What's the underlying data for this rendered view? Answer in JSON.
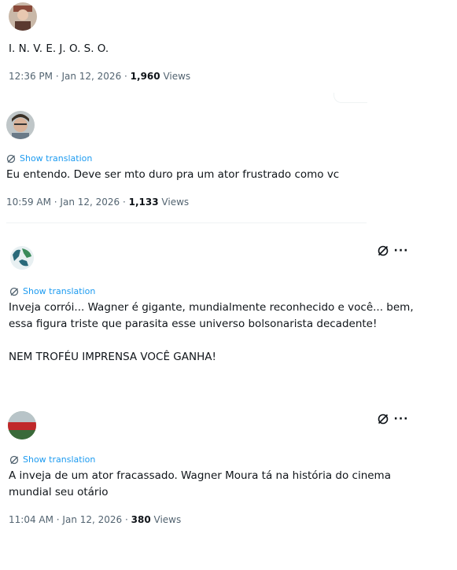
{
  "tweets": [
    {
      "text": "I. N. V. E. J. O. S. O.",
      "time": "12:36 PM",
      "date": "Jan 12, 2026",
      "views_count": "1,960",
      "views_label": "Views"
    },
    {
      "translation_label": "Show translation",
      "text": "Eu entendo. Deve ser mto duro pra um ator frustrado como vc",
      "time": "10:59 AM",
      "date": "Jan 12, 2026",
      "views_count": "1,133",
      "views_label": "Views"
    },
    {
      "translation_label": "Show translation",
      "text": "Inveja corrói... Wagner é gigante, mundialmente reconhecido e você... bem,\nessa figura triste que parasita esse universo bolsonarista decadente!\n\nNEM TROFÉU IMPRENSA VOCÊ GANHA!"
    },
    {
      "translation_label": "Show translation",
      "text": "A inveja de um ator fracassado. Wagner Moura tá na história do cinema\nmundial seu otário",
      "time": "11:04 AM",
      "date": "Jan 12, 2026",
      "views_count": "380",
      "views_label": "Views"
    }
  ],
  "separator": " · ",
  "icons": {
    "translate": "grok-translate-icon",
    "more": "more-options-icon"
  },
  "colors": {
    "link": "#1d9bf0",
    "secondary_text": "#536471",
    "primary_text": "#0f1419"
  }
}
